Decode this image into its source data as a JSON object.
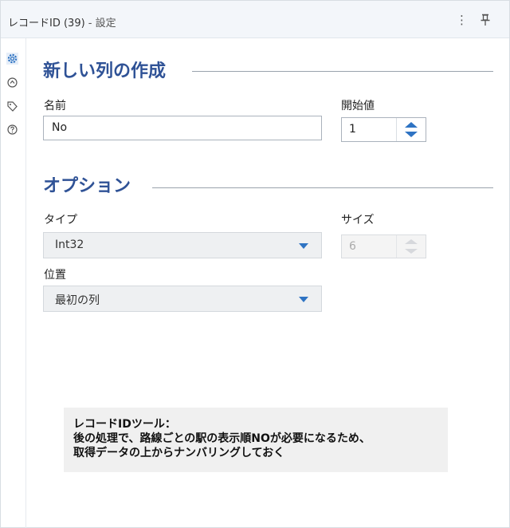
{
  "header": {
    "title": "レコードID (39)",
    "subtitle": " - 設定",
    "menu_icon": "kebab-icon",
    "pin_icon": "pin-icon"
  },
  "rail": {
    "icons": [
      "settings-icon",
      "annotation-icon",
      "tag-icon",
      "help-icon"
    ],
    "accent": "#2e73c3"
  },
  "section_new_column": {
    "title": "新しい列の作成",
    "name_label": "名前",
    "name_value": "No",
    "start_label": "開始値",
    "start_value": "1"
  },
  "section_options": {
    "title": "オプション",
    "type_label": "タイプ",
    "type_value": "Int32",
    "size_label": "サイズ",
    "size_value": "6",
    "position_label": "位置",
    "position_value": "最初の列"
  },
  "note": {
    "line1": "レコードIDツール：",
    "line2": "後の処理で、路線ごとの駅の表示順NOが必要になるため、",
    "line3": "取得データの上からナンバリングしておく"
  },
  "colors": {
    "section_title": "#2f5296",
    "header_bg": "#f3f6fa",
    "note_bg": "#f0f0f0"
  }
}
